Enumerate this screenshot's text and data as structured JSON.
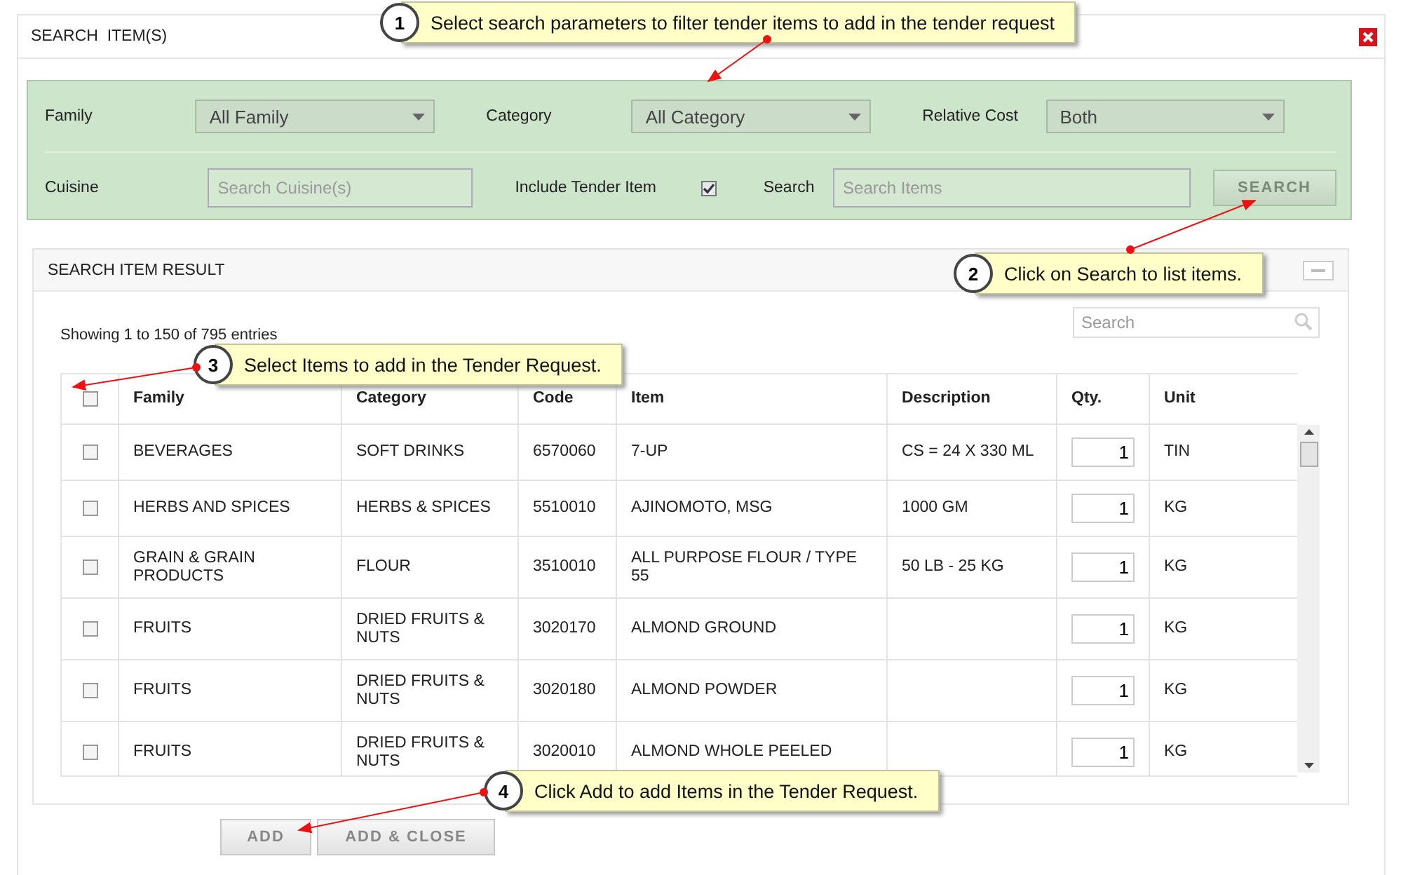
{
  "dialog": {
    "title": "SEARCH  ITEM(S)"
  },
  "filters": {
    "family": {
      "label": "Family",
      "value": "All Family"
    },
    "category": {
      "label": "Category",
      "value": "All Category"
    },
    "relative_cost": {
      "label": "Relative Cost",
      "value": "Both"
    },
    "cuisine": {
      "label": "Cuisine",
      "placeholder": "Search Cuisine(s)"
    },
    "include_tender": {
      "label": "Include Tender Item",
      "checked": true
    },
    "search": {
      "label": "Search",
      "placeholder": "Search Items"
    },
    "search_button": "SEARCH"
  },
  "results": {
    "title": "SEARCH ITEM RESULT",
    "info": "Showing 1 to 150 of 795 entries",
    "search_placeholder": "Search",
    "columns": [
      "Family",
      "Category",
      "Code",
      "Item",
      "Description",
      "Qty.",
      "Unit"
    ],
    "header_checked": false,
    "rows": [
      {
        "checked": false,
        "cells": [
          "BEVERAGES",
          "SOFT DRINKS",
          "6570060",
          "7-UP",
          "CS = 24 X 330 ML",
          "1",
          "TIN"
        ]
      },
      {
        "checked": false,
        "cells": [
          "HERBS AND SPICES",
          "HERBS & SPICES",
          "5510010",
          "AJINOMOTO, MSG",
          "1000 GM",
          "1",
          "KG"
        ]
      },
      {
        "checked": false,
        "cells": [
          "GRAIN & GRAIN PRODUCTS",
          "FLOUR",
          "3510010",
          "ALL PURPOSE FLOUR / TYPE 55",
          "50 LB - 25 KG",
          "1",
          "KG"
        ]
      },
      {
        "checked": false,
        "cells": [
          "FRUITS",
          "DRIED FRUITS & NUTS",
          "3020170",
          "ALMOND GROUND",
          "",
          "1",
          "KG"
        ]
      },
      {
        "checked": false,
        "cells": [
          "FRUITS",
          "DRIED FRUITS & NUTS",
          "3020180",
          "ALMOND POWDER",
          "",
          "1",
          "KG"
        ]
      },
      {
        "checked": false,
        "cells": [
          "FRUITS",
          "DRIED FRUITS & NUTS",
          "3020010",
          "ALMOND WHOLE PEELED",
          "",
          "1",
          "KG"
        ]
      }
    ]
  },
  "buttons": [
    "ADD",
    "ADD & CLOSE"
  ],
  "callouts": [
    {
      "number": "1",
      "text": "Select search parameters to filter tender items to add in the tender request"
    },
    {
      "number": "2",
      "text": "Click on Search to list items."
    },
    {
      "number": "3",
      "text": "Select Items to add in the Tender Request."
    },
    {
      "number": "4",
      "text": "Click Add to add Items in the Tender Request."
    }
  ]
}
